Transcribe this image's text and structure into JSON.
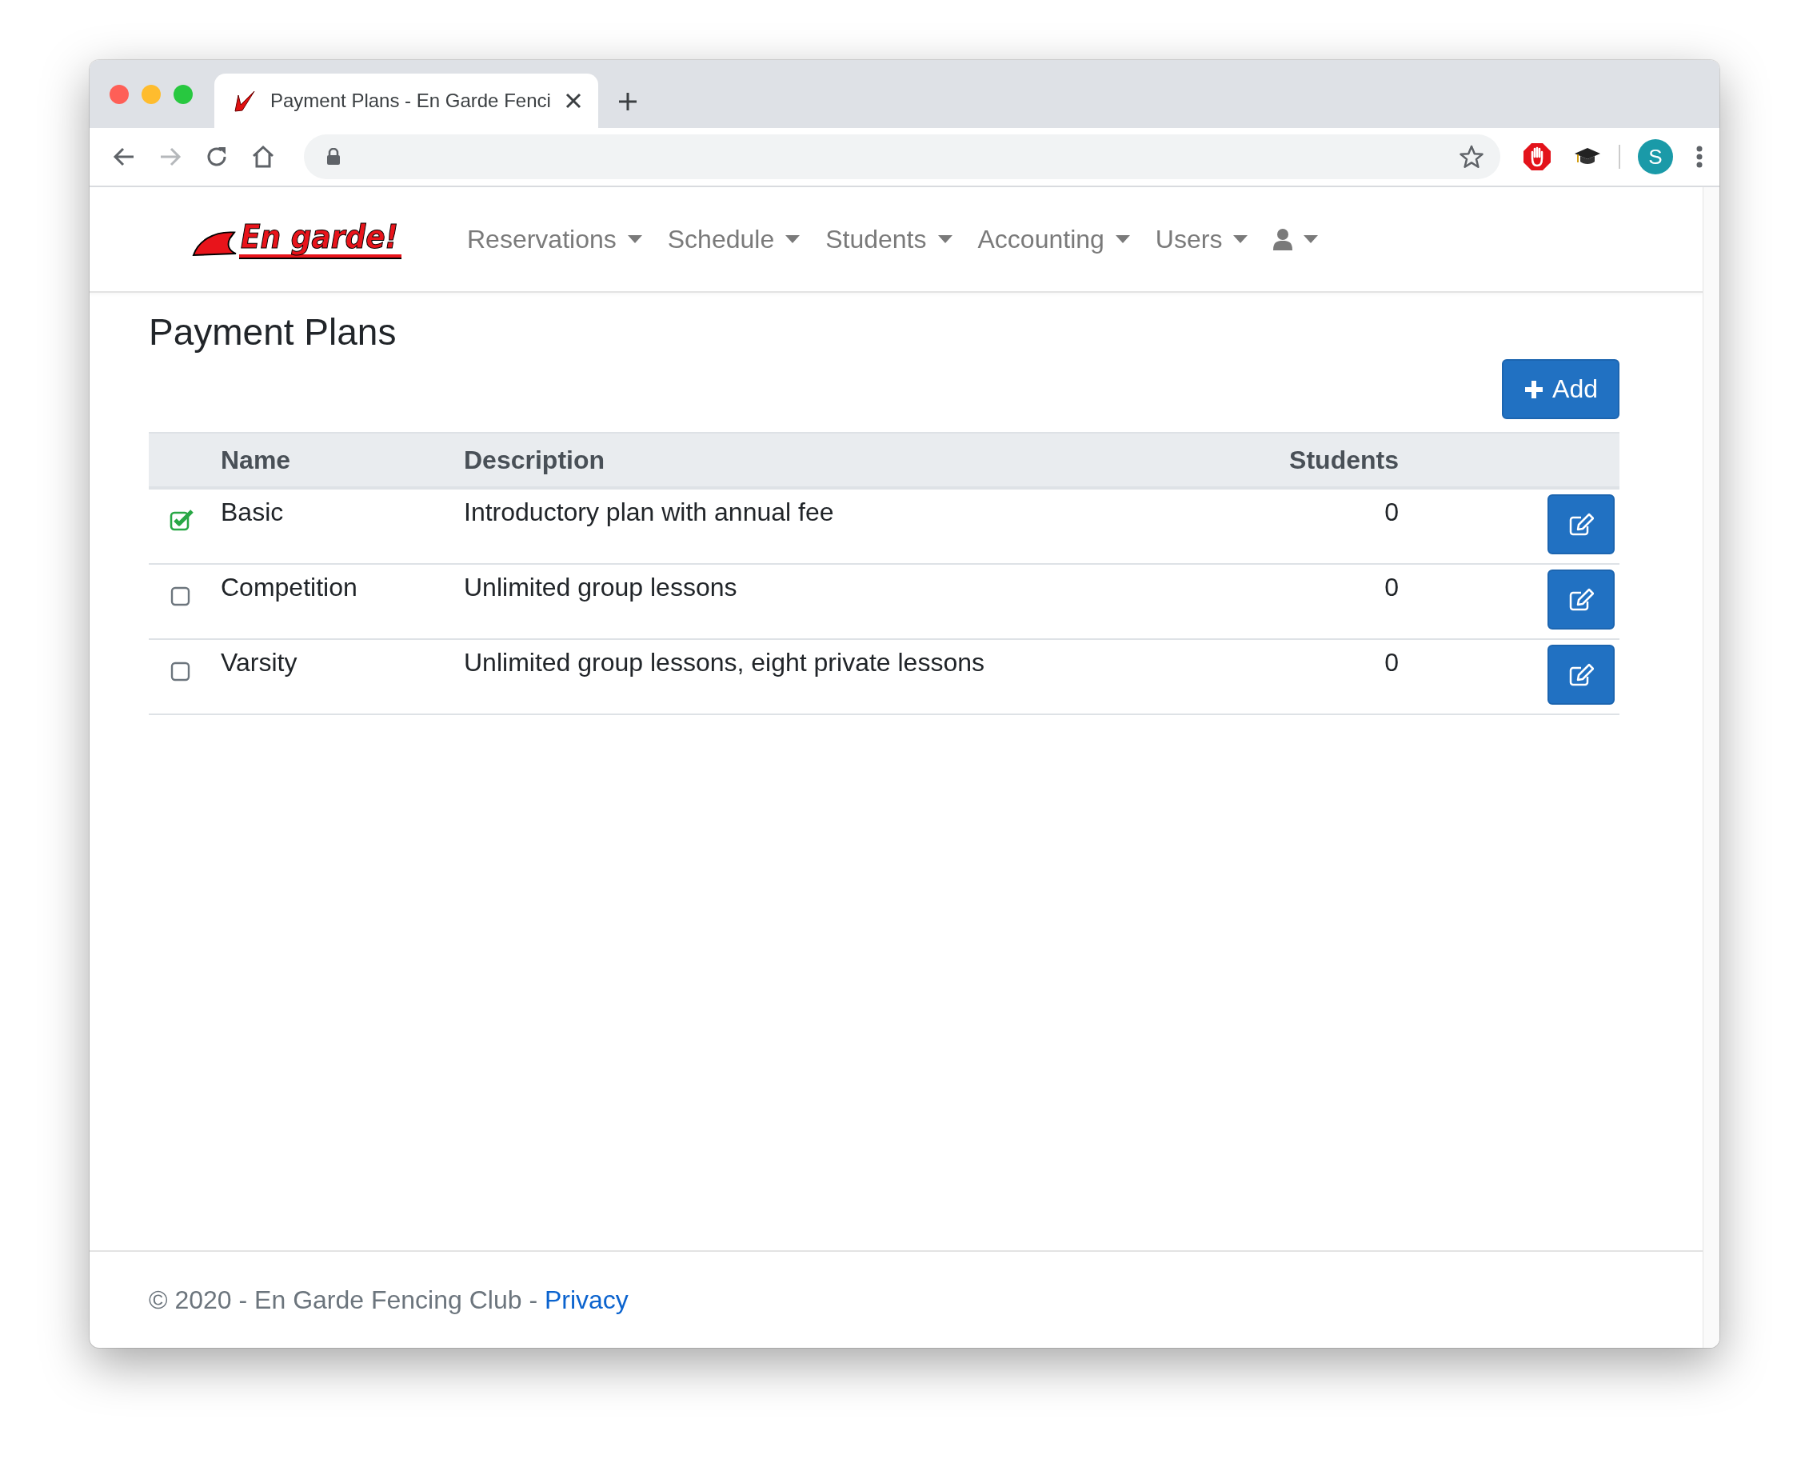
{
  "browser": {
    "tab_title": "Payment Plans - En Garde Fenci",
    "avatar_initial": "S"
  },
  "navbar": {
    "logo_text": "En garde!",
    "items": [
      {
        "label": "Reservations"
      },
      {
        "label": "Schedule"
      },
      {
        "label": "Students"
      },
      {
        "label": "Accounting"
      },
      {
        "label": "Users"
      }
    ]
  },
  "page_title": "Payment Plans",
  "add_button": "Add",
  "table": {
    "columns": [
      "Name",
      "Description",
      "Students"
    ],
    "rows": [
      {
        "checked": true,
        "name": "Basic",
        "description": "Introductory plan with annual fee",
        "students": "0"
      },
      {
        "checked": false,
        "name": "Competition",
        "description": "Unlimited group lessons",
        "students": "0"
      },
      {
        "checked": false,
        "name": "Varsity",
        "description": "Unlimited group lessons, eight private lessons",
        "students": "0"
      }
    ]
  },
  "footer": {
    "text": "© 2020 - En Garde Fencing Club -",
    "link": "Privacy"
  }
}
